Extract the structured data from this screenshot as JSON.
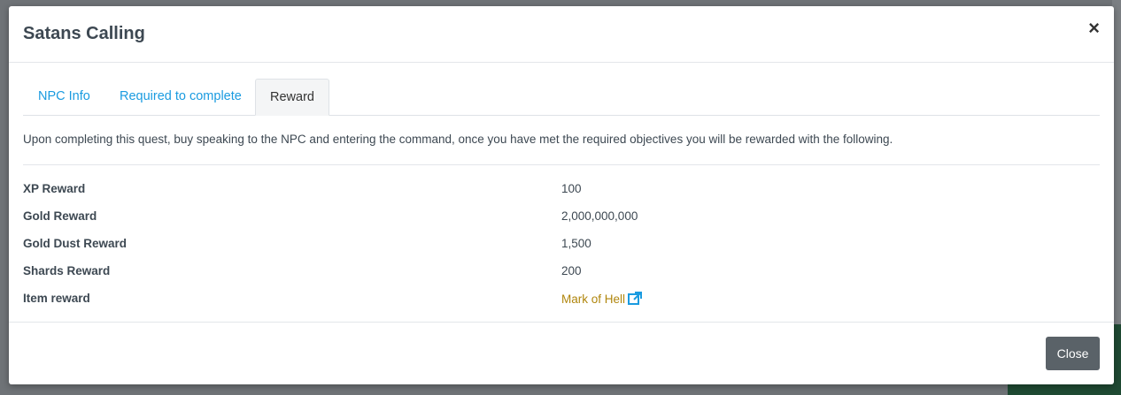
{
  "modal": {
    "title": "Satans Calling",
    "close_icon": "×",
    "close_button": "Close"
  },
  "tabs": [
    {
      "label": "NPC Info",
      "active": false
    },
    {
      "label": "Required to complete",
      "active": false
    },
    {
      "label": "Reward",
      "active": true
    }
  ],
  "reward": {
    "description": "Upon completing this quest, buy speaking to the NPC and entering the command, once you have met the required objectives you will be rewarded with the following.",
    "rows": [
      {
        "label": "XP Reward",
        "value": "100"
      },
      {
        "label": "Gold Reward",
        "value": "2,000,000,000"
      },
      {
        "label": "Gold Dust Reward",
        "value": "1,500"
      },
      {
        "label": "Shards Reward",
        "value": "200"
      },
      {
        "label": "Item reward",
        "value": "Mark of Hell",
        "icon": "external-link-icon"
      }
    ]
  },
  "colors": {
    "link": "#b0860d",
    "tab_link": "#1a9be0",
    "icon": "#1a9be0",
    "button": "#5a6268"
  }
}
